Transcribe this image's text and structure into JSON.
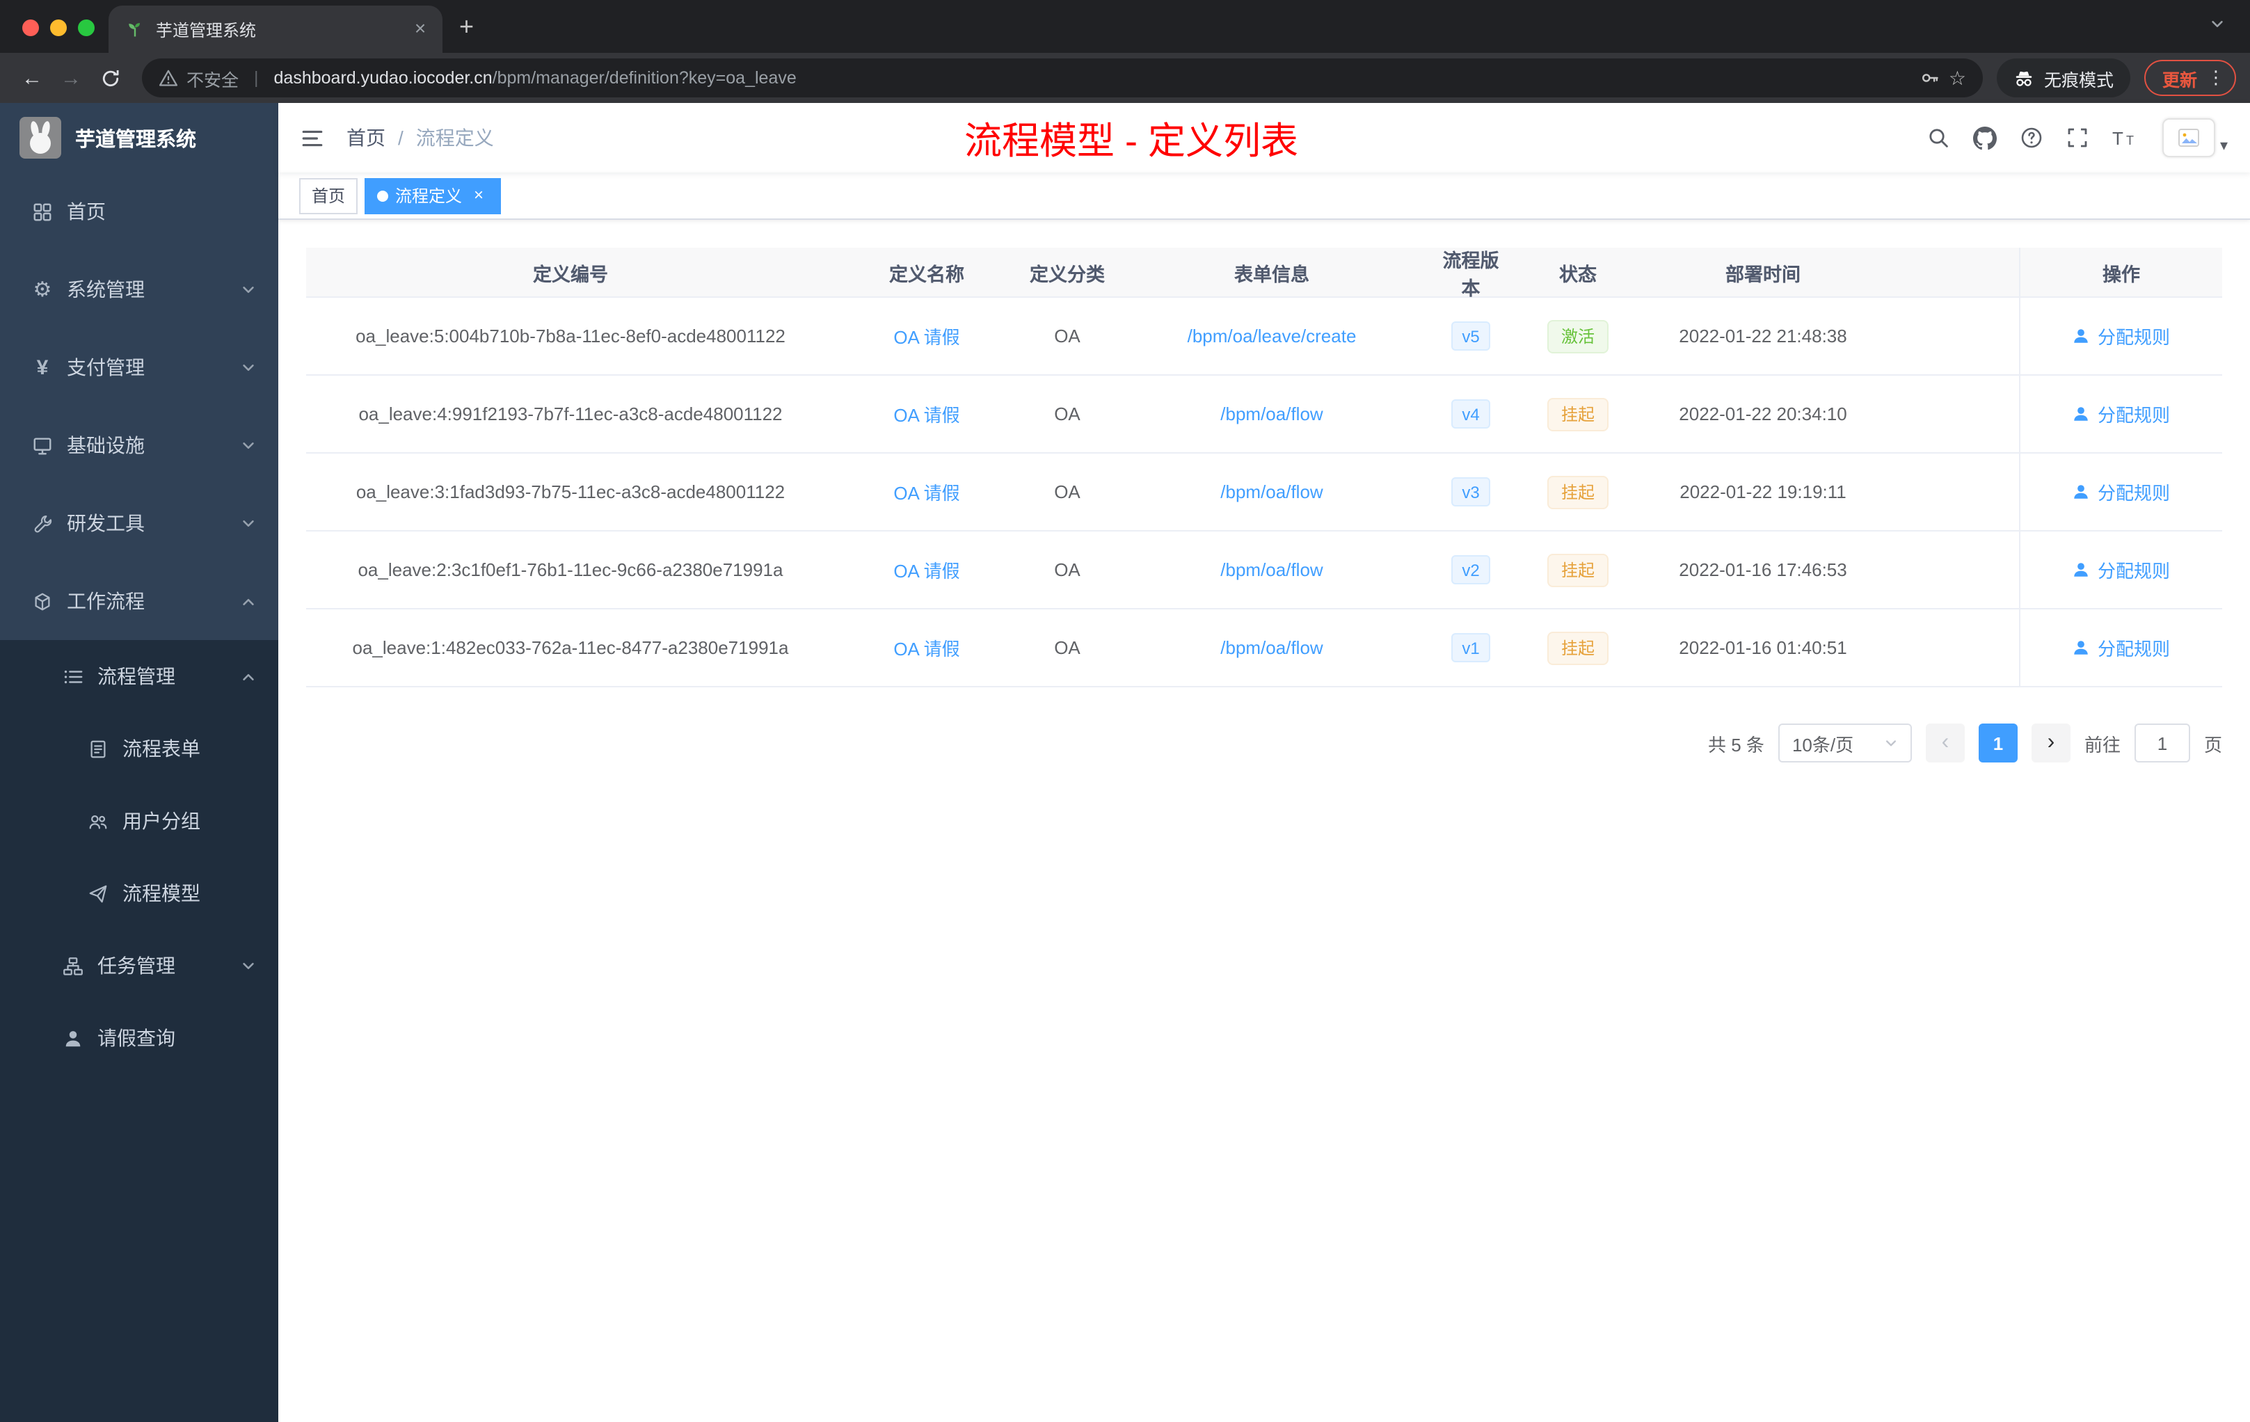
{
  "colors": {
    "accent": "#409eff",
    "success": "#67c23a",
    "warning": "#e6a23c",
    "annotation_red": "#ff0000",
    "sidebar_bg": "#304156",
    "submenu_bg": "#1f2d3d"
  },
  "browser": {
    "tab_title": "芋道管理系统",
    "security_label": "不安全",
    "url_domain": "dashboard.yudao.iocoder.cn",
    "url_path": "/bpm/manager/definition?key=oa_leave",
    "incognito_label": "无痕模式",
    "update_label": "更新"
  },
  "sidebar": {
    "logo_title": "芋道管理系统",
    "items": [
      {
        "label": "首页",
        "icon": "dashboard-icon"
      },
      {
        "label": "系统管理",
        "icon": "gear-icon",
        "state": "collapsed"
      },
      {
        "label": "支付管理",
        "icon": "payment-icon",
        "state": "collapsed"
      },
      {
        "label": "基础设施",
        "icon": "infrastructure-icon",
        "state": "collapsed"
      },
      {
        "label": "研发工具",
        "icon": "devtools-icon",
        "state": "collapsed"
      },
      {
        "label": "工作流程",
        "icon": "workflow-icon",
        "state": "expanded"
      },
      {
        "label": "流程管理",
        "icon": "process-manage-icon",
        "state": "expanded"
      },
      {
        "label": "流程表单",
        "icon": "form-icon"
      },
      {
        "label": "用户分组",
        "icon": "user-group-icon"
      },
      {
        "label": "流程模型",
        "icon": "model-icon"
      },
      {
        "label": "任务管理",
        "icon": "task-icon",
        "state": "collapsed"
      },
      {
        "label": "请假查询",
        "icon": "person-icon"
      }
    ]
  },
  "navbar": {
    "breadcrumb": {
      "home": "首页",
      "separator": "/",
      "current": "流程定义"
    },
    "annotation": "流程模型 - 定义列表"
  },
  "tags_view": {
    "tags": [
      {
        "label": "首页",
        "active": false
      },
      {
        "label": "流程定义",
        "active": true
      }
    ]
  },
  "table": {
    "columns": [
      "定义编号",
      "定义名称",
      "定义分类",
      "表单信息",
      "流程版本",
      "状态",
      "部署时间",
      "操作"
    ],
    "rows": [
      {
        "id": "oa_leave:5:004b710b-7b8a-11ec-8ef0-acde48001122",
        "name": "OA 请假",
        "category": "OA",
        "form": "/bpm/oa/leave/create",
        "version": "v5",
        "status": "激活",
        "status_type": "success",
        "time": "2022-01-22 21:48:38",
        "action": "分配规则"
      },
      {
        "id": "oa_leave:4:991f2193-7b7f-11ec-a3c8-acde48001122",
        "name": "OA 请假",
        "category": "OA",
        "form": "/bpm/oa/flow",
        "version": "v4",
        "status": "挂起",
        "status_type": "warning",
        "time": "2022-01-22 20:34:10",
        "action": "分配规则"
      },
      {
        "id": "oa_leave:3:1fad3d93-7b75-11ec-a3c8-acde48001122",
        "name": "OA 请假",
        "category": "OA",
        "form": "/bpm/oa/flow",
        "version": "v3",
        "status": "挂起",
        "status_type": "warning",
        "time": "2022-01-22 19:19:11",
        "action": "分配规则"
      },
      {
        "id": "oa_leave:2:3c1f0ef1-76b1-11ec-9c66-a2380e71991a",
        "name": "OA 请假",
        "category": "OA",
        "form": "/bpm/oa/flow",
        "version": "v2",
        "status": "挂起",
        "status_type": "warning",
        "time": "2022-01-16 17:46:53",
        "action": "分配规则"
      },
      {
        "id": "oa_leave:1:482ec033-762a-11ec-8477-a2380e71991a",
        "name": "OA 请假",
        "category": "OA",
        "form": "/bpm/oa/flow",
        "version": "v1",
        "status": "挂起",
        "status_type": "warning",
        "time": "2022-01-16 01:40:51",
        "action": "分配规则"
      }
    ]
  },
  "pagination": {
    "total": "共 5 条",
    "page_size": "10条/页",
    "prev": "‹",
    "next": "›",
    "current_page": "1",
    "goto_label": "前往",
    "goto_value": "1",
    "unit_label": "页"
  }
}
